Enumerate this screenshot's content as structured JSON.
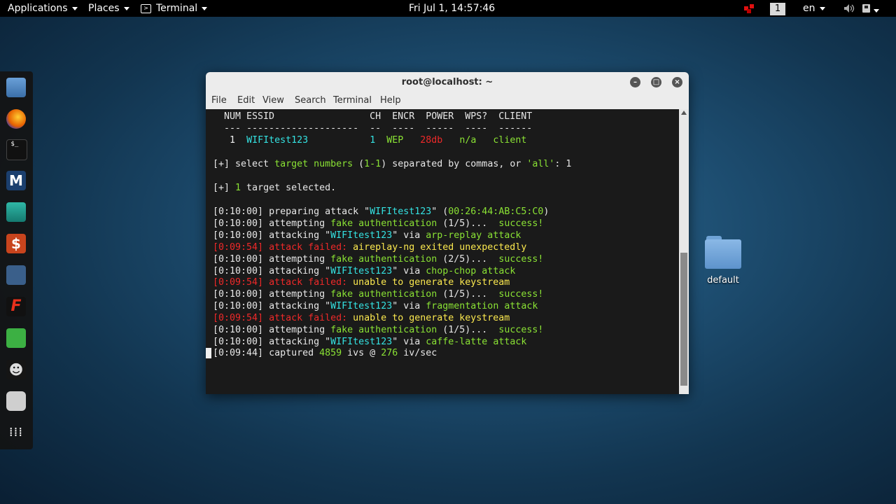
{
  "topbar": {
    "applications": "Applications",
    "places": "Places",
    "terminal": "Terminal",
    "clock": "Fri Jul  1, 14:57:46",
    "workspace": "1",
    "language": "en"
  },
  "desktop": {
    "folder_label": "default"
  },
  "window": {
    "title": "root@localhost: ~",
    "menu": [
      "File",
      "Edit",
      "View",
      "Search",
      "Terminal",
      "Help"
    ]
  },
  "terminal": {
    "header": "  NUM ESSID                 CH  ENCR  POWER  WPS?  CLIENT",
    "divider": "  --- --------------------  --  ----  -----  ----  ------",
    "row": {
      "num": "1",
      "essid": "WIFItest123",
      "ch": "1",
      "encr": "WEP",
      "power": "28db",
      "wps": "n/a",
      "client": "client"
    },
    "select_prompt": {
      "prefix": "[+] select ",
      "target_numbers": "target numbers",
      "range": "(1-1)",
      "middle": " separated by commas, or ",
      "all": "'all'",
      "suffix": ": 1"
    },
    "selected": {
      "prefix": "[+] ",
      "count": "1",
      "suffix": " target selected."
    },
    "log": [
      {
        "time": "[0:10:00]",
        "type": "prep",
        "text": " preparing attack \"",
        "essid": "WIFItest123",
        "mid": "\" (",
        "mac": "00:26:44:AB:C5:C0",
        "end": ")"
      },
      {
        "time": "[0:10:00]",
        "type": "auth",
        "text": " attempting ",
        "hl": "fake authentication",
        "mid": " (1/5)...  ",
        "end": "success!"
      },
      {
        "time": "[0:10:00]",
        "type": "attack",
        "text": " attacking \"",
        "essid": "WIFItest123",
        "mid": "\" via ",
        "method": "arp-replay attack"
      },
      {
        "time": "[0:09:54]",
        "type": "fail",
        "failed": " attack failed: ",
        "reason": "aireplay-ng exited unexpectedly"
      },
      {
        "time": "[0:10:00]",
        "type": "auth",
        "text": " attempting ",
        "hl": "fake authentication",
        "mid": " (2/5)...  ",
        "end": "success!"
      },
      {
        "time": "[0:10:00]",
        "type": "attack",
        "text": " attacking \"",
        "essid": "WIFItest123",
        "mid": "\" via ",
        "method": "chop-chop attack"
      },
      {
        "time": "[0:09:54]",
        "type": "fail",
        "failed": " attack failed: ",
        "reason": "unable to generate keystream"
      },
      {
        "time": "[0:10:00]",
        "type": "auth",
        "text": " attempting ",
        "hl": "fake authentication",
        "mid": " (1/5)...  ",
        "end": "success!"
      },
      {
        "time": "[0:10:00]",
        "type": "attack",
        "text": " attacking \"",
        "essid": "WIFItest123",
        "mid": "\" via ",
        "method": "fragmentation attack"
      },
      {
        "time": "[0:09:54]",
        "type": "fail",
        "failed": " attack failed: ",
        "reason": "unable to generate keystream"
      },
      {
        "time": "[0:10:00]",
        "type": "auth",
        "text": " attempting ",
        "hl": "fake authentication",
        "mid": " (1/5)...  ",
        "end": "success!"
      },
      {
        "time": "[0:10:00]",
        "type": "attack",
        "text": " attacking \"",
        "essid": "WIFItest123",
        "mid": "\" via ",
        "method": "caffe-latte attack"
      }
    ],
    "captured": {
      "time": "[0:09:44]",
      "text": " captured ",
      "ivs": "4859",
      "mid": " ivs @ ",
      "rate": "276",
      "end": " iv/sec"
    }
  }
}
